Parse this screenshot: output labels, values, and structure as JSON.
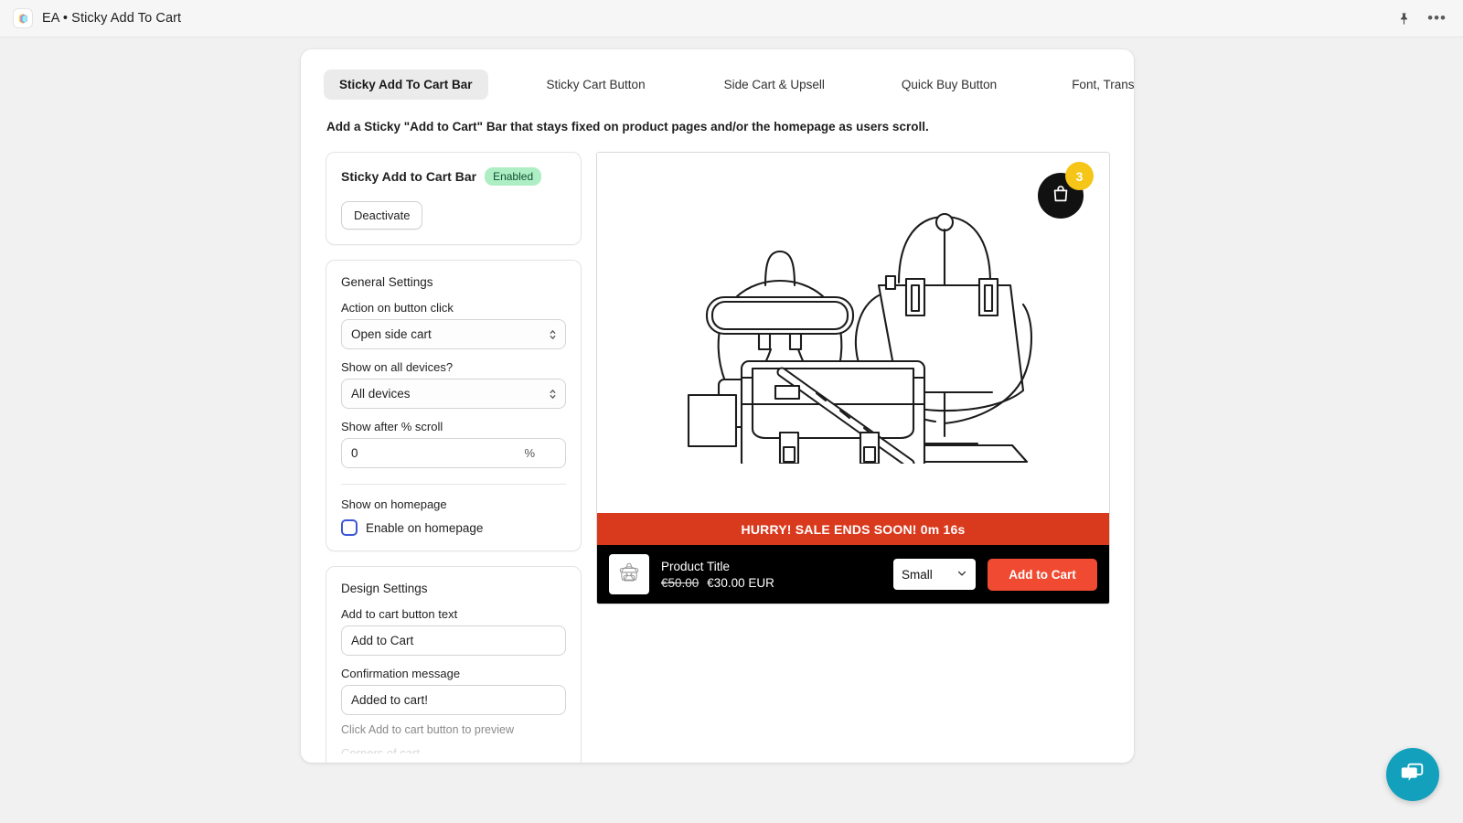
{
  "window": {
    "app_name": "EA • Sticky Add To Cart",
    "app_icon": "layers-logo-icon",
    "pin_icon": "pin-icon",
    "more_icon": "more-options-icon"
  },
  "tabs": [
    {
      "label": "Sticky Add To Cart Bar",
      "active": true
    },
    {
      "label": "Sticky Cart Button",
      "active": false
    },
    {
      "label": "Side Cart & Upsell",
      "active": false
    },
    {
      "label": "Quick Buy Button",
      "active": false
    },
    {
      "label": "Font, Translation, CSS, JS",
      "active": false
    }
  ],
  "page": {
    "description": "Add a Sticky \"Add to Cart\" Bar that stays fixed on product pages and/or the homepage as users scroll."
  },
  "status_card": {
    "title": "Sticky Add to Cart Bar",
    "badge": "Enabled",
    "badge_color": "#aeeec4",
    "button": "Deactivate"
  },
  "general_settings": {
    "title": "General Settings",
    "action_label": "Action on button click",
    "action_value": "Open side cart",
    "devices_label": "Show on all devices?",
    "devices_value": "All devices",
    "scroll_label": "Show after % scroll",
    "scroll_value": "0",
    "scroll_suffix": "%",
    "homepage_label": "Show on homepage",
    "homepage_checkbox_label": "Enable on homepage",
    "homepage_checked": false
  },
  "design_settings": {
    "title": "Design Settings",
    "button_text_label": "Add to cart button text",
    "button_text_value": "Add to Cart",
    "confirm_label": "Confirmation message",
    "confirm_value": "Added to cart!",
    "hint": "Click Add to cart button to preview",
    "clipped_label": "Corners of cart"
  },
  "preview": {
    "cart_icon": "shopping-bag-icon",
    "cart_count": "3",
    "cart_badge_color": "#f5c518",
    "product_illustration": "bags-line-art-illustration",
    "sale_bar_text": "HURRY! SALE ENDS SOON! 0m 16s",
    "sale_bar_color": "#d93a1e",
    "thumbnail_icon": "backpack-icon",
    "product_title": "Product Title",
    "price_old": "€50.00",
    "price_new": "€30.00 EUR",
    "variant_value": "Small",
    "add_to_cart_label": "Add to Cart",
    "add_to_cart_color": "#f04a32"
  },
  "chat": {
    "icon": "chat-bubbles-icon",
    "color": "#12a0bd"
  }
}
